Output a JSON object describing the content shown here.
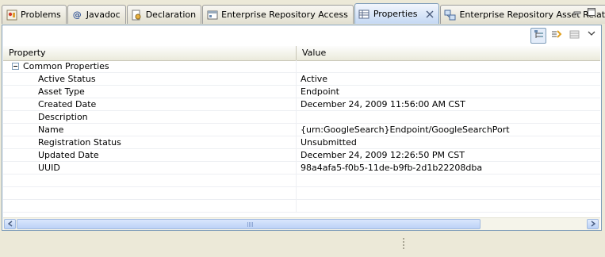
{
  "tabs": [
    {
      "label": "Problems",
      "icon": "problems-icon"
    },
    {
      "label": "Javadoc",
      "icon": "javadoc-icon"
    },
    {
      "label": "Declaration",
      "icon": "declaration-icon"
    },
    {
      "label": "Enterprise Repository Access",
      "icon": "repository-access-icon"
    },
    {
      "label": "Properties",
      "icon": "properties-icon",
      "active": true
    },
    {
      "label": "Enterprise Repository Asset Relations",
      "icon": "asset-relations-icon"
    }
  ],
  "table": {
    "columns": [
      "Property",
      "Value"
    ],
    "category": "Common Properties",
    "rows": [
      {
        "property": "Active Status",
        "value": "Active"
      },
      {
        "property": "Asset Type",
        "value": "Endpoint"
      },
      {
        "property": "Created Date",
        "value": "December 24, 2009 11:56:00 AM CST"
      },
      {
        "property": "Description",
        "value": ""
      },
      {
        "property": "Name",
        "value": "{urn:GoogleSearch}Endpoint/GoogleSearchPort"
      },
      {
        "property": "Registration Status",
        "value": "Unsubmitted"
      },
      {
        "property": "Updated Date",
        "value": "December 24, 2009 12:26:50 PM CST"
      },
      {
        "property": "UUID",
        "value": "98a4afa5-f0b5-11de-b9fb-2d1b22208dba"
      }
    ]
  },
  "colors": {
    "accent": "#7f9db9",
    "active_tab": "#c4d8f3",
    "chrome": "#ece9d8"
  }
}
